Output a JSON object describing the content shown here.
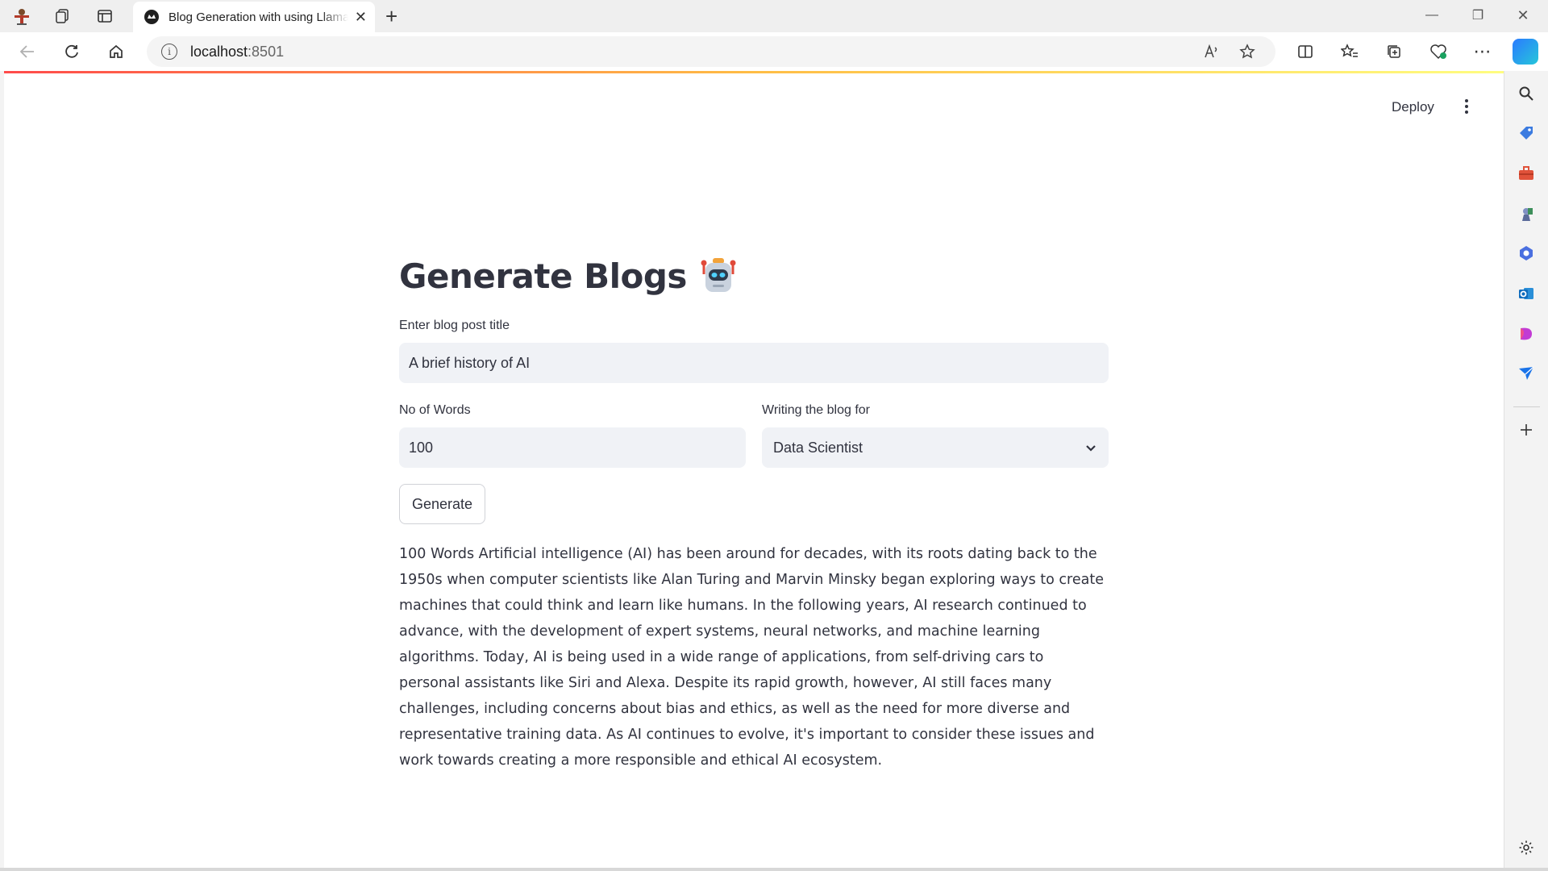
{
  "browser": {
    "tab_title": "Blog Generation with using Llama",
    "url_host": "localhost",
    "url_port": ":8501",
    "new_tab_glyph": "+",
    "tab_close_glyph": "✕",
    "minimize_glyph": "—",
    "restore_glyph": "❐",
    "close_glyph": "✕"
  },
  "app": {
    "deploy_label": "Deploy",
    "title": "Generate Blogs",
    "title_icon": "robot-icon",
    "blog_title_label": "Enter blog post title",
    "blog_title_value": "A brief history of AI",
    "words_label": "No of Words",
    "words_value": "100",
    "audience_label": "Writing the blog for",
    "audience_value": "Data Scientist",
    "generate_label": "Generate",
    "result_text": "100 Words Artificial intelligence (AI) has been around for decades, with its roots dating back to the 1950s when computer scientists like Alan Turing and Marvin Minsky began exploring ways to create machines that could think and learn like humans. In the following years, AI research continued to advance, with the development of expert systems, neural networks, and machine learning algorithms. Today, AI is being used in a wide range of applications, from self-driving cars to personal assistants like Siri and Alexa. Despite its rapid growth, however, AI still faces many challenges, including concerns about bias and ethics, as well as the need for more diverse and representative training data. As AI continues to evolve, it's important to consider these issues and work towards creating a more responsible and ethical AI ecosystem."
  },
  "colors": {
    "accent_red": "#ff4b4b",
    "input_bg": "#f0f2f6",
    "text": "#31333f"
  },
  "sidepanel_icons": [
    "search-icon",
    "tag-icon",
    "toolbox-icon",
    "chess-icon",
    "copilot-icon",
    "outlook-icon",
    "designer-icon",
    "send-icon",
    "add-icon",
    "settings-icon"
  ]
}
